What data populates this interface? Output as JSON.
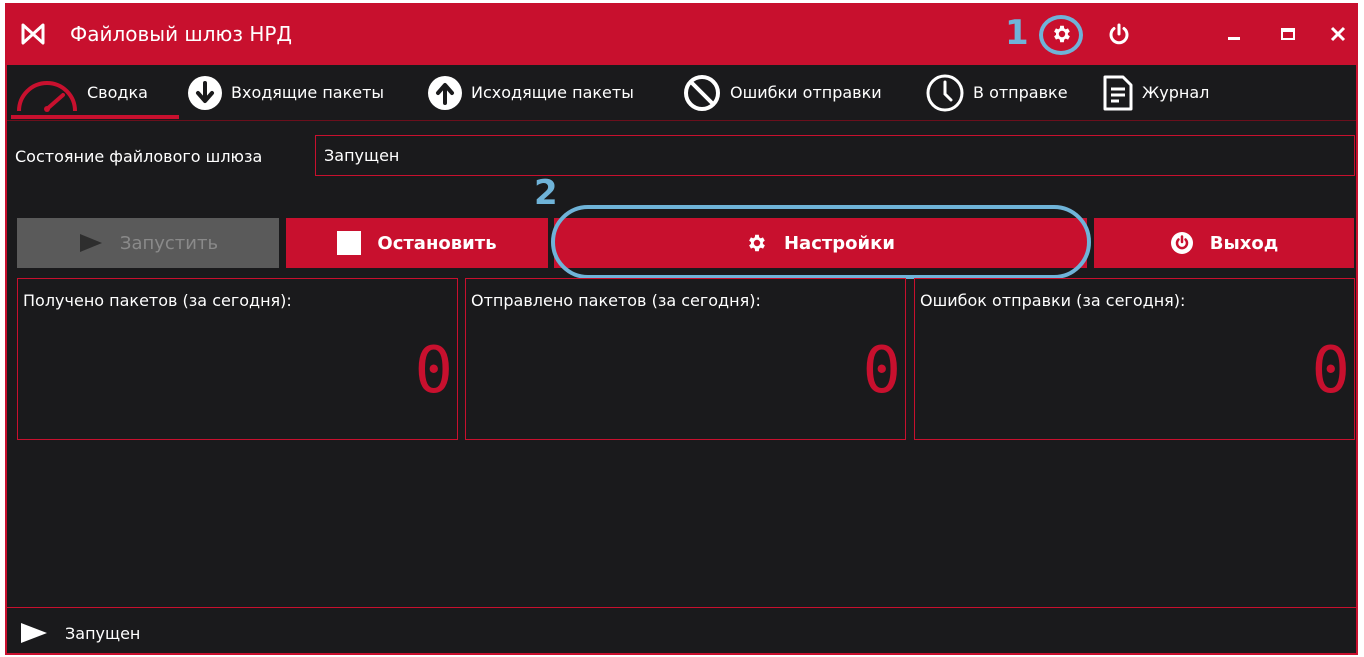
{
  "window": {
    "title": "Файловый шлюз НРД",
    "accent_color": "#c8102e",
    "annotation_color": "#6fb3d8",
    "annotation_1": "1",
    "annotation_2": "2",
    "title_icons": [
      "settings-gear-icon",
      "power-icon",
      "minimize-icon",
      "maximize-icon",
      "close-icon"
    ]
  },
  "nav": {
    "items": [
      {
        "label": "Сводка",
        "icon": "speedometer-icon",
        "active": true
      },
      {
        "label": "Входящие пакеты",
        "icon": "arrow-down-circle-icon"
      },
      {
        "label": "Исходящие пакеты",
        "icon": "arrow-up-circle-icon"
      },
      {
        "label": "Ошибки отправки",
        "icon": "prohibited-icon"
      },
      {
        "label": "В отправке",
        "icon": "clock-icon"
      },
      {
        "label": "Журнал",
        "icon": "document-icon"
      }
    ]
  },
  "status": {
    "label": "Состояние файлового шлюза",
    "value": "Запущен"
  },
  "actions": {
    "start": "Запустить",
    "stop": "Остановить",
    "settings": "Настройки",
    "exit": "Выход"
  },
  "stats": [
    {
      "title": "Получено пакетов (за сегодня):",
      "value": "0"
    },
    {
      "title": "Отправлено пакетов (за сегодня):",
      "value": "0"
    },
    {
      "title": "Ошибок отправки (за сегодня):",
      "value": "0"
    }
  ],
  "statusbar": {
    "text": "Запущен",
    "icon": "play-icon"
  }
}
